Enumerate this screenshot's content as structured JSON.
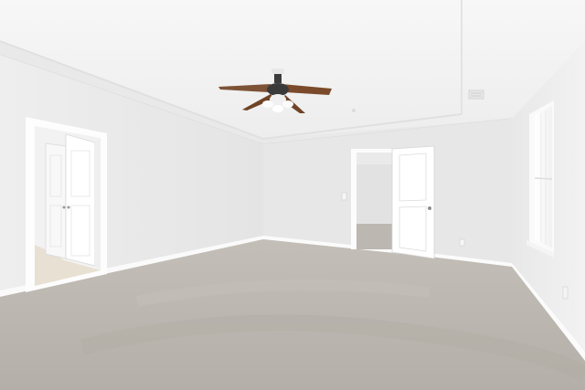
{
  "scene": {
    "description_kind": "empty carpeted room interior photo",
    "colors": {
      "ceiling": "#f3f3f3",
      "wall_left": "#ececec",
      "wall_back": "#e6e6e6",
      "wall_right": "#eeeeee",
      "carpet": "#bdb8b1",
      "trim": "#ffffff",
      "fan_blade": "#7a4a2a",
      "tile_floor": "#e5dccd"
    },
    "objects": [
      {
        "name": "ceiling-fan-icon"
      },
      {
        "name": "left-open-doorway"
      },
      {
        "name": "center-doorway-with-open-door"
      },
      {
        "name": "right-window"
      },
      {
        "name": "carpet-floor"
      }
    ]
  }
}
